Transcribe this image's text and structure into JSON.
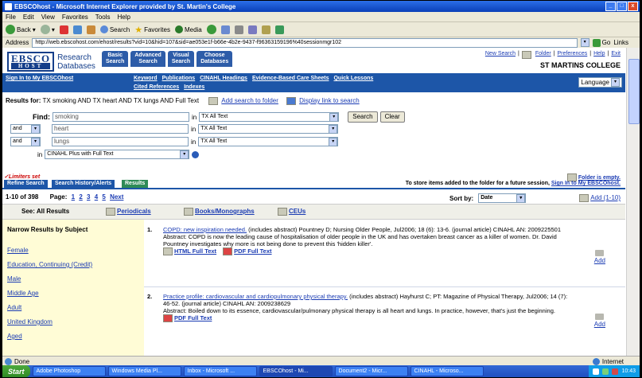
{
  "window": {
    "title": "EBSCOhost - Microsoft Internet Explorer provided by St. Martin's College",
    "controls": [
      "_",
      "□",
      "x"
    ]
  },
  "menu": [
    "File",
    "Edit",
    "View",
    "Favorites",
    "Tools",
    "Help"
  ],
  "toolbar": {
    "back": "Back",
    "search": "Search",
    "favorites": "Favorites",
    "media": "Media"
  },
  "address": {
    "label": "Address",
    "url": "http://web.ebscohost.com/ehost/results?vid=10&hid=107&sid=ae053e1f-b66e-4b2e-9437-f96363159196%40sessionmgr102",
    "go": "Go",
    "links": "Links"
  },
  "ebsco": {
    "logo_top": "EBSCO",
    "logo_bottom": "HOST",
    "logo_text_1": "Research",
    "logo_text_2": "Databases",
    "tabs": [
      {
        "l1": "Basic",
        "l2": "Search"
      },
      {
        "l1": "Advanced",
        "l2": "Search"
      },
      {
        "l1": "Visual",
        "l2": "Search"
      },
      {
        "l1": "Choose",
        "l2": "Databases"
      }
    ],
    "top_links": [
      "New Search",
      "Folder",
      "Preferences",
      "Help",
      "Exit"
    ],
    "college": "ST MARTINS COLLEGE",
    "signin": "Sign In to My EBSCOhost",
    "sublinks": [
      "Keyword",
      "Publications",
      "CINAHL Headings",
      "Evidence-Based Care Sheets",
      "Quick Lessons"
    ],
    "sublinks2": [
      "Cited References",
      "Indexes"
    ],
    "language": "Language"
  },
  "results_for": {
    "label": "Results for:",
    "query": "TX smoking AND TX heart AND TX lungs AND Full Text",
    "add_to_folder": "Add search to folder",
    "display_link": "Display link to search"
  },
  "search": {
    "find_label": "Find:",
    "rows": [
      {
        "op": "",
        "term": "smoking",
        "in": "in",
        "field": "TX All Text"
      },
      {
        "op": "and",
        "term": "heart",
        "in": "in",
        "field": "TX All Text"
      },
      {
        "op": "and",
        "term": "lungs",
        "in": "in",
        "field": "TX All Text"
      }
    ],
    "in_label": "in",
    "database": "CINAHL Plus with Full Text",
    "search_btn": "Search",
    "clear_btn": "Clear"
  },
  "limiters": "✓Limiters set",
  "folder_empty": "Folder is empty.",
  "result_tabs": [
    "Refine Search",
    "Search History/Alerts",
    "Results"
  ],
  "store_text": "To store items added to the folder for a future session,",
  "store_link": "Sign In to My EBSCOhost.",
  "paging": {
    "range": "1-10 of 398",
    "page_label": "Page:",
    "pages": [
      "1",
      "2",
      "3",
      "4",
      "5",
      "Next"
    ],
    "sort_label": "Sort by:",
    "sort_value": "Date",
    "add_range": "Add (1-10)"
  },
  "see_all": {
    "label": "See: All Results",
    "links": [
      "Periodicals",
      "Books/Monographs",
      "CEUs"
    ]
  },
  "narrow": {
    "title": "Narrow Results by Subject",
    "items": [
      "Female",
      "Education, Continuing (Credit)",
      "Male",
      "Middle Age",
      "Adult",
      "United Kingdom",
      "Aged"
    ]
  },
  "records": [
    {
      "num": "1.",
      "title": "COPD: new inspiration needed.",
      "meta": "(includes abstract) Pountney D; Nursing Older People, Jul2006; 18 (6): 13-6. (journal article) CINAHL AN: 2009225501",
      "abstract": "Abstract: COPD is now the leading cause of hospitalisation of older people in the UK and has overtaken breast cancer as a killer of women. Dr. David Pountney investigates why more is not being done to prevent this 'hidden killer'.",
      "links": [
        "HTML Full Text",
        "PDF Full Text"
      ],
      "add": "Add"
    },
    {
      "num": "2.",
      "title": "Practice profile: cardiovascular and cardiopulmonary physical therapy.",
      "meta": "(includes abstract) Hayhurst C; PT: Magazine of Physical Therapy, Jul2006; 14 (7): 46-52. (journal article) CINAHL AN: 2009238629",
      "abstract": "Abstract: Boiled down to its essence, cardiovascular/pulmonary physical therapy is all heart and lungs. In practice, however, that's just the beginning.",
      "links": [
        "PDF Full Text"
      ],
      "add": "Add"
    }
  ],
  "status": {
    "left": "Done",
    "zone": "Internet"
  },
  "taskbar": {
    "start": "Start",
    "tasks": [
      "Adobe Photoshop",
      "Windows Media Pl...",
      "Inbox - Microsoft ...",
      "EBSCOhost - Mi...",
      "Document2 - Micr...",
      "CINAHL - Microso..."
    ],
    "clock": "10:43"
  }
}
